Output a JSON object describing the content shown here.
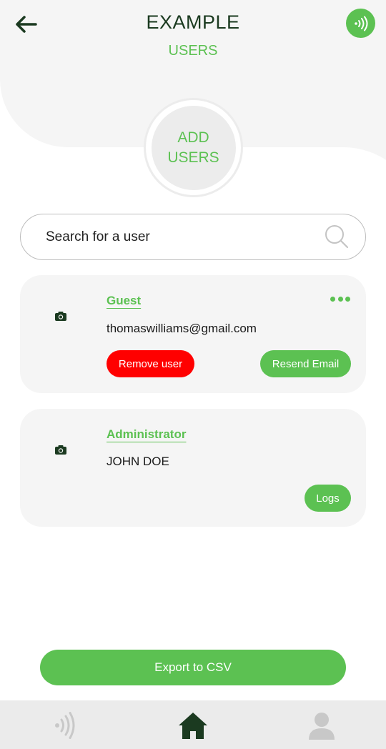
{
  "header": {
    "title": "EXAMPLE",
    "subtitle": "USERS",
    "back_icon": "arrow-left-icon",
    "nfc_icon": "nfc-signal-icon"
  },
  "add_users": {
    "line1": "ADD",
    "line2": "USERS"
  },
  "search": {
    "placeholder": "Search for a user",
    "value": "",
    "icon": "search-icon"
  },
  "users": [
    {
      "role": "Guest",
      "detail": "thomaswilliams@gmail.com",
      "avatar_icon": "camera-icon",
      "has_menu": true,
      "actions": [
        "Remove user",
        "Resend Email"
      ]
    },
    {
      "role": "Administrator",
      "detail": "JOHN DOE",
      "avatar_icon": "camera-icon",
      "has_menu": false,
      "actions": [
        "Logs"
      ]
    }
  ],
  "export": {
    "label": "Export to CSV"
  },
  "bottom_nav": [
    {
      "icon": "nfc-signal-icon",
      "active": false
    },
    {
      "icon": "home-icon",
      "active": true
    },
    {
      "icon": "user-icon",
      "active": false
    }
  ],
  "colors": {
    "accent": "#5cc152",
    "danger": "#ff0000",
    "dark": "#1b3a20",
    "card_bg": "#f5f5f5"
  }
}
